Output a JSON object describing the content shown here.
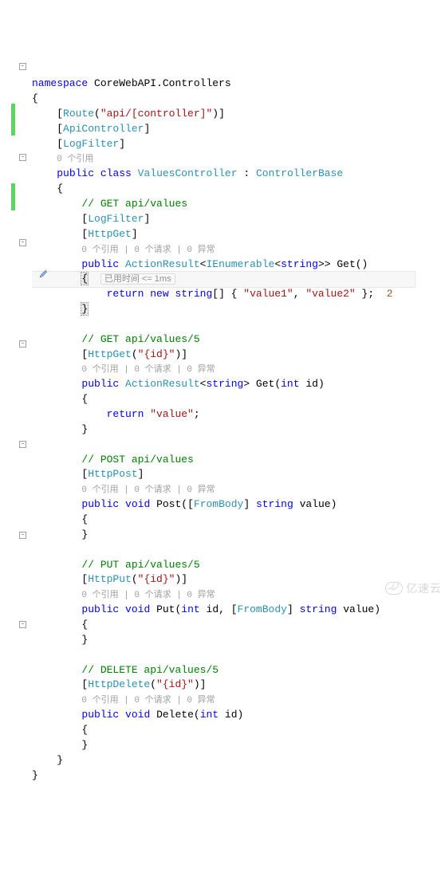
{
  "watermark": "亿速云",
  "ns": {
    "kw_namespace": "namespace",
    "name": "CoreWebAPI.Controllers"
  },
  "class_attrs": {
    "route": {
      "name": "Route",
      "arg": "\"api/[controller]\""
    },
    "api": {
      "name": "ApiController"
    },
    "log": {
      "name": "LogFilter"
    }
  },
  "codelens_class": "0 个引用",
  "class_decl": {
    "kw_public": "public",
    "kw_class": "class",
    "name": "ValuesController",
    "colon": ":",
    "base": "ControllerBase"
  },
  "get_all": {
    "comment": "// GET api/values",
    "attr_log": "LogFilter",
    "attr_get": "HttpGet",
    "codelens": "0 个引用 | 0 个请求 | 0 异常",
    "kw_public": "public",
    "ret1": "ActionResult",
    "ret2": "IEnumerable",
    "ret3": "string",
    "name": "Get",
    "perf": "已用时间 <= 1ms",
    "kw_return": "return",
    "kw_new": "new",
    "arr_type": "string",
    "v1": "\"value1\"",
    "v2": "\"value2\"",
    "annot": "2"
  },
  "get_one": {
    "comment": "// GET api/values/5",
    "attr": "HttpGet",
    "attr_arg": "\"{id}\"",
    "codelens": "0 个引用 | 0 个请求 | 0 异常",
    "kw_public": "public",
    "ret1": "ActionResult",
    "ret2": "string",
    "name": "Get",
    "p_type": "int",
    "p_name": "id",
    "kw_return": "return",
    "val": "\"value\""
  },
  "post": {
    "comment": "// POST api/values",
    "attr": "HttpPost",
    "codelens": "0 个引用 | 0 个请求 | 0 异常",
    "kw_public": "public",
    "ret": "void",
    "name": "Post",
    "frombody": "FromBody",
    "p_type": "string",
    "p_name": "value"
  },
  "put": {
    "comment": "// PUT api/values/5",
    "attr": "HttpPut",
    "attr_arg": "\"{id}\"",
    "codelens": "0 个引用 | 0 个请求 | 0 异常",
    "kw_public": "public",
    "ret": "void",
    "name": "Put",
    "p1_type": "int",
    "p1_name": "id",
    "frombody": "FromBody",
    "p2_type": "string",
    "p2_name": "value"
  },
  "delete": {
    "comment": "// DELETE api/values/5",
    "attr": "HttpDelete",
    "attr_arg": "\"{id}\"",
    "codelens": "0 个引用 | 0 个请求 | 0 异常",
    "kw_public": "public",
    "ret": "void",
    "name": "Delete",
    "p_type": "int",
    "p_name": "id"
  }
}
